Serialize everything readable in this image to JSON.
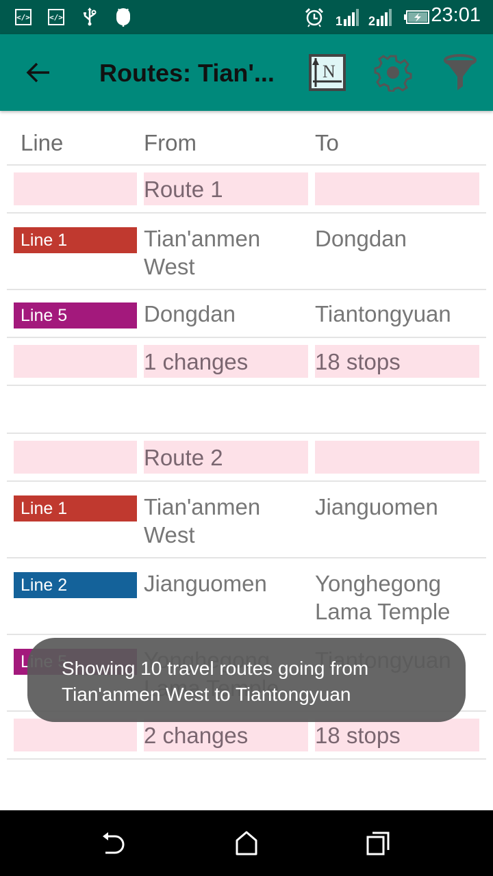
{
  "status_bar": {
    "icons_left": [
      "code-notification-icon",
      "code-notification-icon",
      "usb-icon",
      "android-debug-icon"
    ],
    "icons_right": [
      "alarm-icon",
      "signal-sim1-icon",
      "signal-sim2-icon",
      "battery-charging-icon"
    ],
    "code_glyph": "</>",
    "sim1_label": "1",
    "sim2_label": "2",
    "time": "23:01"
  },
  "app_bar": {
    "title": "Routes: Tian'...",
    "actions": [
      "north-map-icon",
      "settings-icon",
      "filter-icon"
    ]
  },
  "table": {
    "headers": {
      "line": "Line",
      "from": "From",
      "to": "To"
    },
    "routes": [
      {
        "title": "Route 1",
        "legs": [
          {
            "line": "Line 1",
            "color": "#c0392f",
            "from": "Tian'anmen West",
            "to": "Dongdan"
          },
          {
            "line": "Line 5",
            "color": "#a3197c",
            "from": "Dongdan",
            "to": "Tiantongyuan"
          }
        ],
        "changes": "1 changes",
        "stops": "18 stops"
      },
      {
        "title": "Route 2",
        "legs": [
          {
            "line": "Line 1",
            "color": "#c0392f",
            "from": "Tian'anmen West",
            "to": "Jianguomen"
          },
          {
            "line": "Line 2",
            "color": "#14629a",
            "from": "Jianguomen",
            "to": "Yonghegong Lama Temple"
          },
          {
            "line": "Line 5",
            "color": "#a3197c",
            "from": "Yonghegong Lama Temple",
            "to": "Tiantongyuan"
          }
        ],
        "changes": "2 changes",
        "stops": "18 stops"
      }
    ]
  },
  "toast": {
    "line1": "Showing 10 travel routes going from",
    "line2": "Tian'anmen West to Tiantongyuan"
  },
  "nav_bar": {
    "buttons": [
      "back-icon",
      "home-icon",
      "recents-icon"
    ]
  },
  "colors": {
    "status_bar": "#00594d",
    "app_bar": "#00897b",
    "route_highlight": "#fde1e8",
    "line1": "#c0392f",
    "line2": "#14629a",
    "line5": "#a3197c"
  }
}
